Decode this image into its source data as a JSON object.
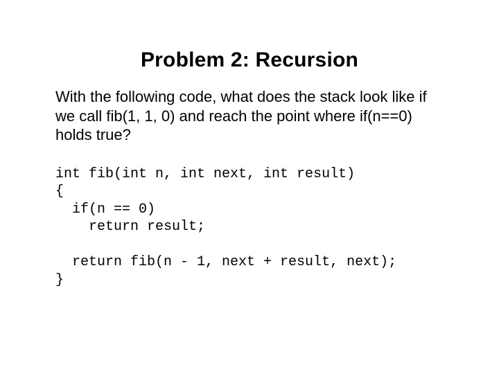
{
  "title": "Problem 2: Recursion",
  "question": "With the following code, what does the stack look like if we call fib(1, 1, 0) and reach the point where if(n==0) holds true?",
  "code": "int fib(int n, int next, int result)\n{\n  if(n == 0)\n    return result;\n\n  return fib(n - 1, next + result, next);\n}"
}
